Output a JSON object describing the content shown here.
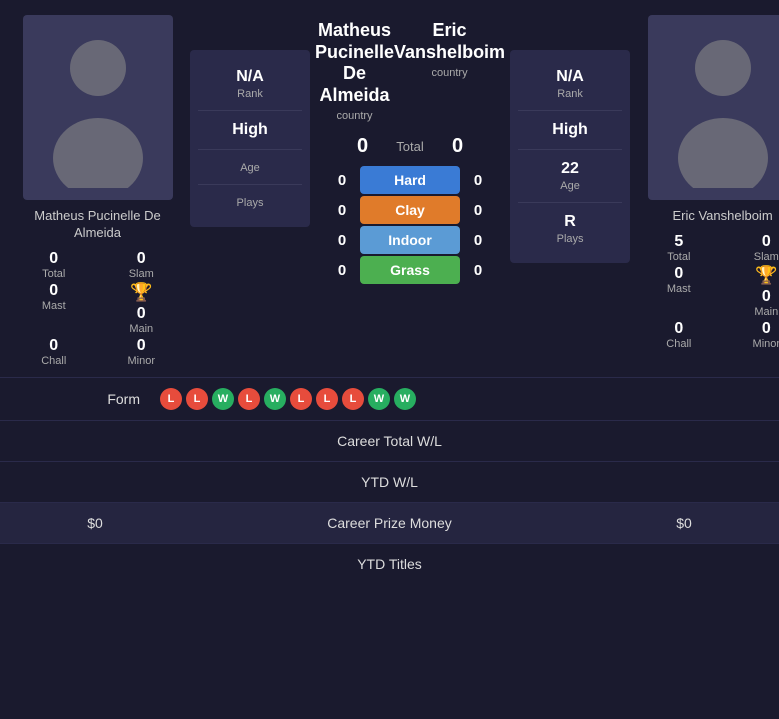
{
  "players": {
    "left": {
      "name": "Matheus Pucinelle De Almeida",
      "name_short": "Matheus Pucinelle De\nAlmeida",
      "country": "country",
      "stats": {
        "total": "0",
        "slam": "0",
        "mast": "0",
        "main": "0",
        "chall": "0",
        "minor": "0"
      },
      "panel": {
        "rank_value": "N/A",
        "rank_label": "Rank",
        "high_value": "High",
        "high_label": "",
        "age_value": "",
        "age_label": "Age",
        "plays_value": "",
        "plays_label": "Plays"
      }
    },
    "right": {
      "name": "Eric Vanshelboim",
      "country": "country",
      "stats": {
        "total": "5",
        "slam": "0",
        "mast": "0",
        "main": "0",
        "chall": "0",
        "minor": "0"
      },
      "panel": {
        "rank_value": "N/A",
        "rank_label": "Rank",
        "high_value": "High",
        "high_label": "",
        "age_value": "22",
        "age_label": "Age",
        "plays_value": "R",
        "plays_label": "Plays"
      }
    }
  },
  "scores": {
    "total_left": "0",
    "total_right": "0",
    "total_label": "Total",
    "hard_left": "0",
    "hard_right": "0",
    "hard_label": "Hard",
    "clay_left": "0",
    "clay_right": "0",
    "clay_label": "Clay",
    "indoor_left": "0",
    "indoor_right": "0",
    "indoor_label": "Indoor",
    "grass_left": "0",
    "grass_right": "0",
    "grass_label": "Grass"
  },
  "form": {
    "label": "Form",
    "badges": [
      "L",
      "L",
      "W",
      "L",
      "W",
      "L",
      "L",
      "L",
      "W",
      "W"
    ]
  },
  "bottom": {
    "career_total_label": "Career Total W/L",
    "ytd_wl_label": "YTD W/L",
    "career_prize_label": "Career Prize Money",
    "ytd_titles_label": "YTD Titles",
    "left_prize": "$0",
    "right_prize": "$0"
  },
  "labels": {
    "total": "Total",
    "slam": "Slam",
    "mast": "Mast",
    "main": "Main",
    "chall": "Chall",
    "minor": "Minor"
  }
}
